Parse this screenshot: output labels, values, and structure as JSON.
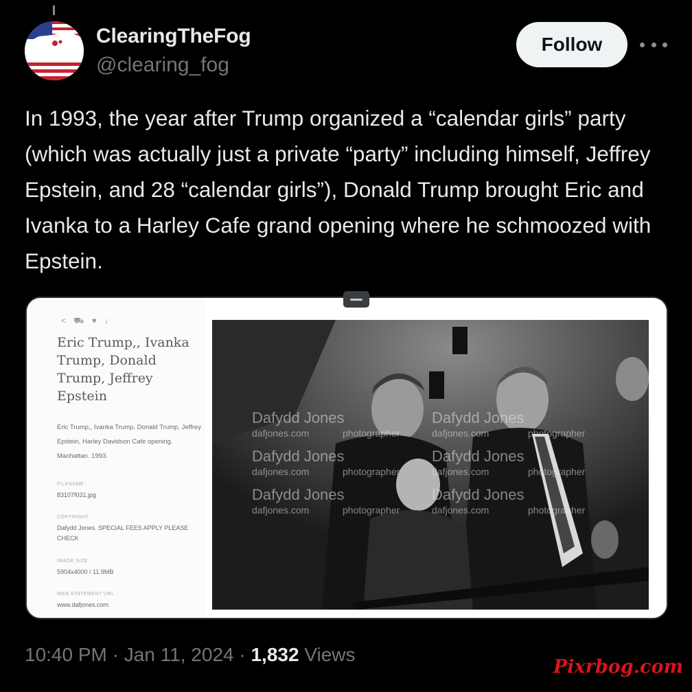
{
  "author": {
    "display_name": "ClearingTheFog",
    "handle": "@clearing_fog",
    "avatar_icon": "flag-map-icon"
  },
  "follow_label": "Follow",
  "more_icon": "more-dots-icon",
  "tweet_text": "In 1993, the year after Trump organized a “calendar girls” party (which was actually just a private “party” including himself, Jeffrey Epstein, and 28 “calendar girls”), Donald Trump brought Eric and Ivanka to a Harley Cafe grand opening where he schmoozed with Epstein.",
  "media": {
    "share_icons": "< ⛟ ♥ ↓",
    "title": "Eric Trump,, Ivanka Trump, Donald Trump, Jeffrey Epstein",
    "caption": "Eric Trump,, Ivanka Trump, Donald Trump, Jeffrey Epstein, Harley Davidson Cafe opening. Manhattan. 1993.",
    "meta": {
      "filename_label": "FILENAME",
      "filename": "83107f031.jpg",
      "copyright_label": "COPYRIGHT",
      "copyright": "Dafydd Jones. SPECIAL FEES APPLY PLEASE CHECK",
      "image_size_label": "IMAGE SIZE",
      "image_size": "5904x4000 / 11.9MB",
      "web_label": "WEB STATEMENT URL",
      "web_url": "www.dafjones.com"
    },
    "photo_watermark": {
      "name": "Dafydd Jones",
      "site": "dafjones.com",
      "role": "photographer"
    }
  },
  "timestamp": {
    "time": "10:40 PM",
    "date": "Jan 11, 2024",
    "views_count": "1,832",
    "views_label": "Views"
  },
  "site_watermark": "Pixrbog.com",
  "colors": {
    "background": "#000000",
    "text": "#e7e9ea",
    "secondary": "#71767b",
    "follow_bg": "#eff3f4",
    "watermark_red": "#d9141b"
  }
}
